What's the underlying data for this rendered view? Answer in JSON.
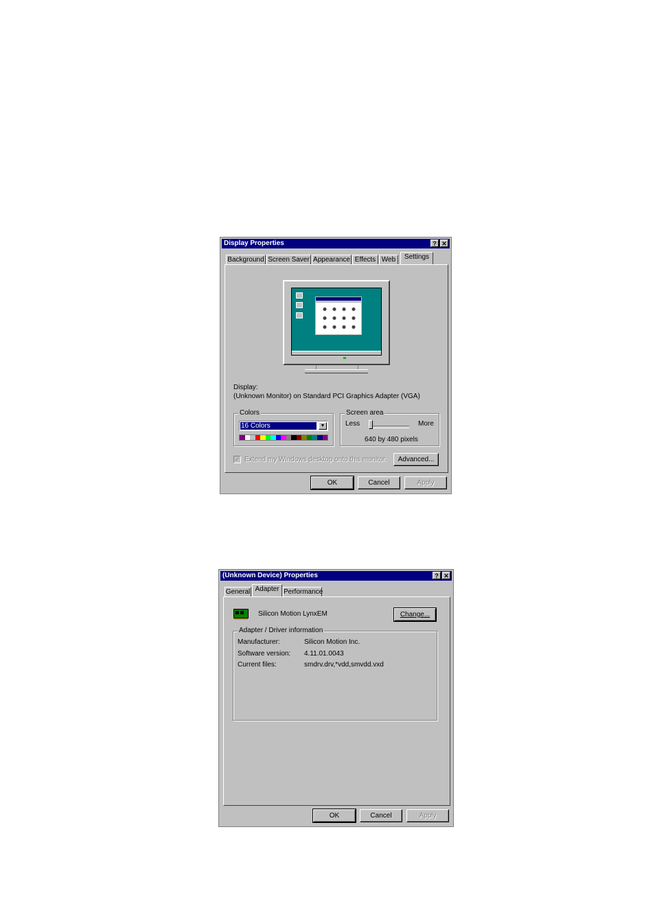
{
  "display_dialog": {
    "title": "Display Properties",
    "help_button": "?",
    "close_button": "✕",
    "tabs": [
      {
        "label": "Background"
      },
      {
        "label": "Screen Saver"
      },
      {
        "label": "Appearance"
      },
      {
        "label": "Effects"
      },
      {
        "label": "Web"
      },
      {
        "label": "Settings"
      }
    ],
    "active_tab": "Settings",
    "display_label": "Display:",
    "display_value": "(Unknown Monitor) on Standard PCI Graphics Adapter (VGA)",
    "colors_group": "Colors",
    "colors_selected": "16 Colors",
    "palette": [
      "#800080",
      "#ffffff",
      "#c0c0c0",
      "#ff0000",
      "#ffff00",
      "#00ff00",
      "#00ffff",
      "#0000ff",
      "#ff00ff",
      "#808080",
      "#000000",
      "#800000",
      "#808000",
      "#008000",
      "#008080",
      "#000080",
      "#800080"
    ],
    "screen_area_group": "Screen area",
    "less_label": "Less",
    "more_label": "More",
    "resolution": "640 by 480 pixels",
    "extend_checkbox": "Extend my Windows desktop onto this monitor.",
    "extend_checked": true,
    "advanced_button": "Advanced...",
    "ok_button": "OK",
    "cancel_button": "Cancel",
    "apply_button": "Apply",
    "preview": {
      "desktop_color": "#008080",
      "desktop_icons": [
        "My Computer",
        "Network Neighborhood",
        "Recycle Bin"
      ]
    }
  },
  "device_dialog": {
    "title": "(Unknown Device) Properties",
    "help_button": "?",
    "close_button": "✕",
    "tabs": [
      {
        "label": "General"
      },
      {
        "label": "Adapter"
      },
      {
        "label": "Performance"
      }
    ],
    "active_tab": "Adapter",
    "adapter_name": "Silicon Motion LynxEM",
    "change_button": "Change...",
    "info_group": "Adapter / Driver information",
    "info_rows": [
      {
        "label": "Manufacturer:",
        "value": "Silicon Motion Inc."
      },
      {
        "label": "Software version:",
        "value": "4.11.01.0043"
      },
      {
        "label": "Current files:",
        "value": "smdrv.drv,*vdd,smvdd.vxd"
      }
    ],
    "ok_button": "OK",
    "cancel_button": "Cancel",
    "apply_button": "Apply"
  }
}
